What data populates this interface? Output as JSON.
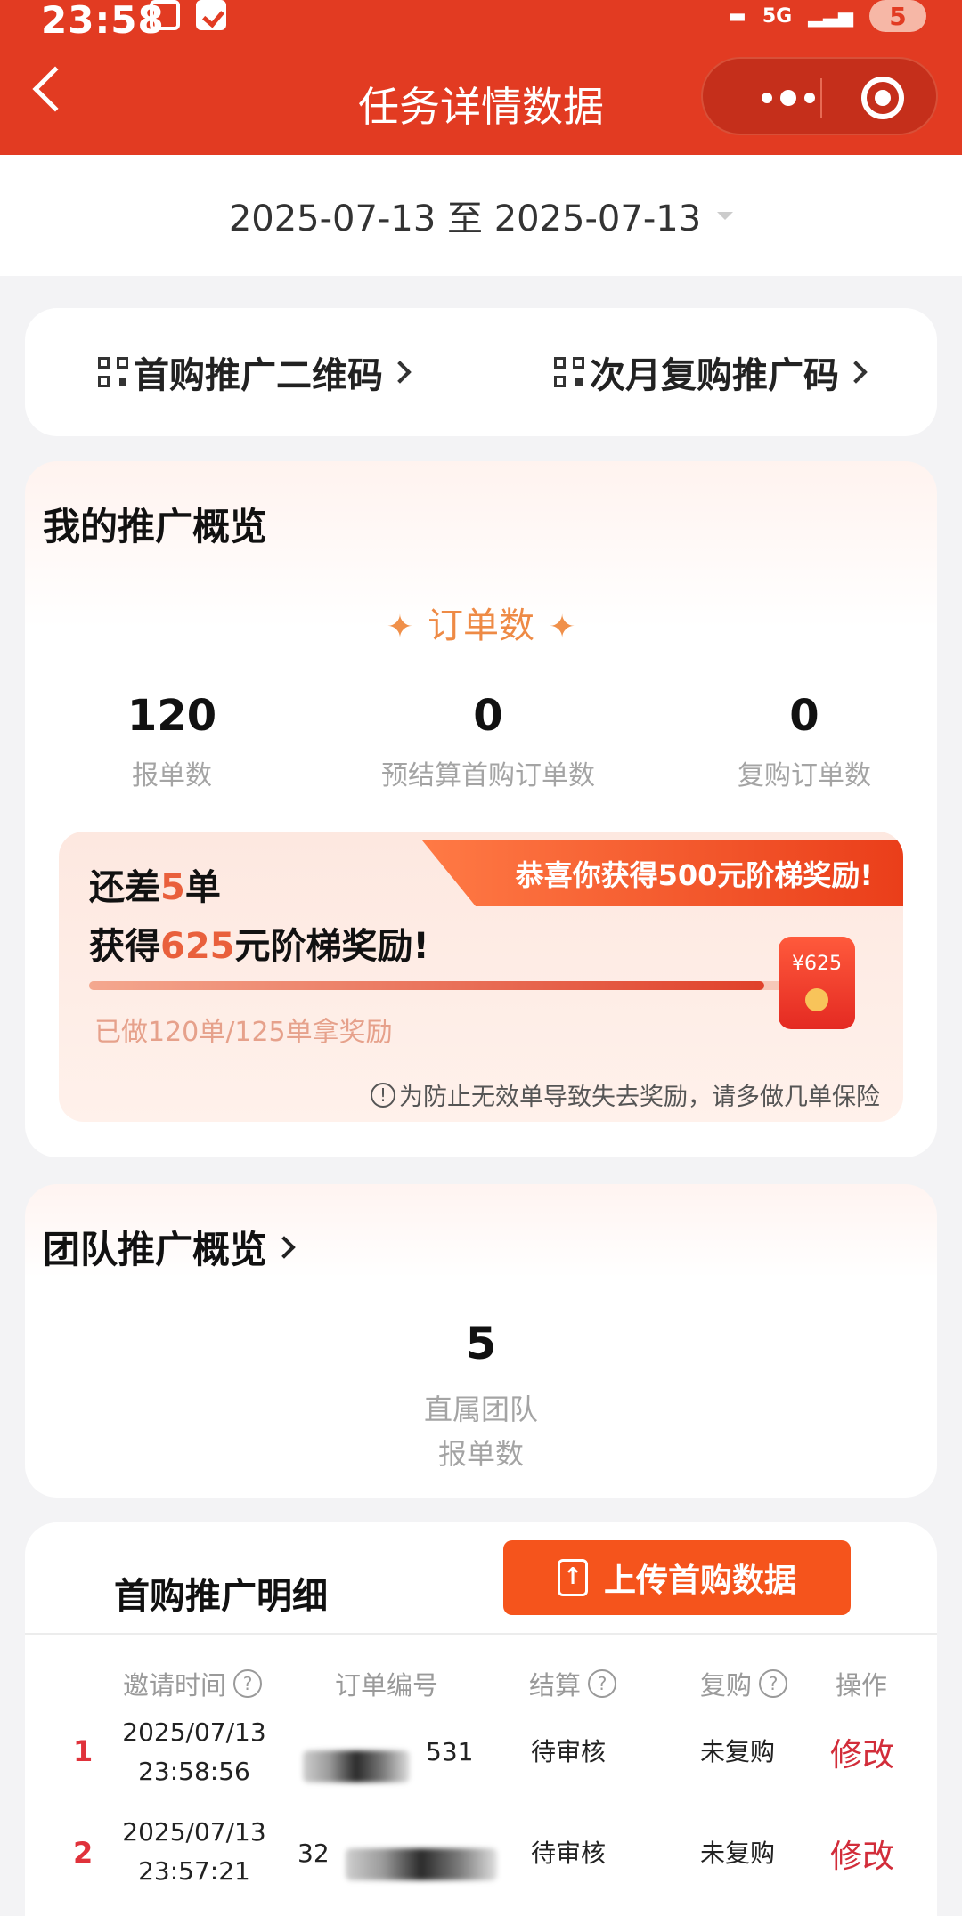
{
  "status_bar": {
    "time": "23:58",
    "network": "5G",
    "battery": "5"
  },
  "nav": {
    "title": "任务详情数据"
  },
  "date_range": {
    "label": "2025-07-13 至 2025-07-13"
  },
  "qr_links": {
    "first_purchase": "首购推广二维码",
    "repurchase": "次月复购推广码"
  },
  "overview": {
    "title": "我的推广概览",
    "orders_label": "订单数",
    "stats": [
      {
        "value": "120",
        "label": "报单数"
      },
      {
        "value": "0",
        "label": "预结算首购订单数"
      },
      {
        "value": "0",
        "label": "复购订单数"
      }
    ],
    "tier": {
      "banner": "恭喜你获得500元阶梯奖励!",
      "line1_prefix": "还差",
      "line1_count": "5",
      "line1_suffix": "单",
      "line2_prefix": "获得",
      "line2_amount": "625",
      "line2_suffix": "元阶梯奖励!",
      "envelope_label": "¥625",
      "progress_text": "已做120单/125单拿奖励",
      "progress_fraction": 0.96,
      "note": "为防止无效单导致失去奖励，请多做几单保险"
    }
  },
  "team": {
    "title": "团队推广概览",
    "value": "5",
    "label_line1": "直属团队",
    "label_line2": "报单数"
  },
  "detail": {
    "title": "首购推广明细",
    "upload_label": "上传首购数据",
    "columns": [
      "邀请时间",
      "订单编号",
      "结算",
      "复购",
      "操作"
    ],
    "rows": [
      {
        "index": "1",
        "date": "2025/07/13",
        "time": "23:58:56",
        "order_prefix": "",
        "order_suffix": "531",
        "settle": "待审核",
        "repurchase": "未复购",
        "action": "修改"
      },
      {
        "index": "2",
        "date": "2025/07/13",
        "time": "23:57:21",
        "order_prefix": "32",
        "order_suffix": "",
        "settle": "待审核",
        "repurchase": "未复购",
        "action": "修改"
      }
    ]
  },
  "colors": {
    "brand_red": "#e23b22",
    "accent_orange": "#f5541c",
    "highlight": "#e9603c",
    "edit_red": "#d22d3a"
  }
}
